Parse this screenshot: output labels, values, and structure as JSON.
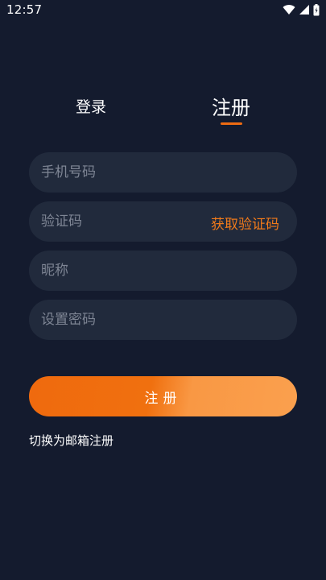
{
  "status_bar": {
    "time": "12:57",
    "icons": [
      "wifi-icon",
      "signal-icon",
      "battery-icon"
    ]
  },
  "tabs": {
    "login_label": "登录",
    "register_label": "注册",
    "active": "register"
  },
  "form": {
    "phone_placeholder": "手机号码",
    "code_placeholder": "验证码",
    "get_code_label": "获取验证码",
    "nickname_placeholder": "昵称",
    "password_placeholder": "设置密码",
    "submit_label": "注册"
  },
  "switch_label": "切换为邮箱注册",
  "colors": {
    "background": "#141b2e",
    "field": "#212a3c",
    "accent": "#ee6b12",
    "button_start": "#ef6a0e",
    "button_end": "#faa04e"
  }
}
